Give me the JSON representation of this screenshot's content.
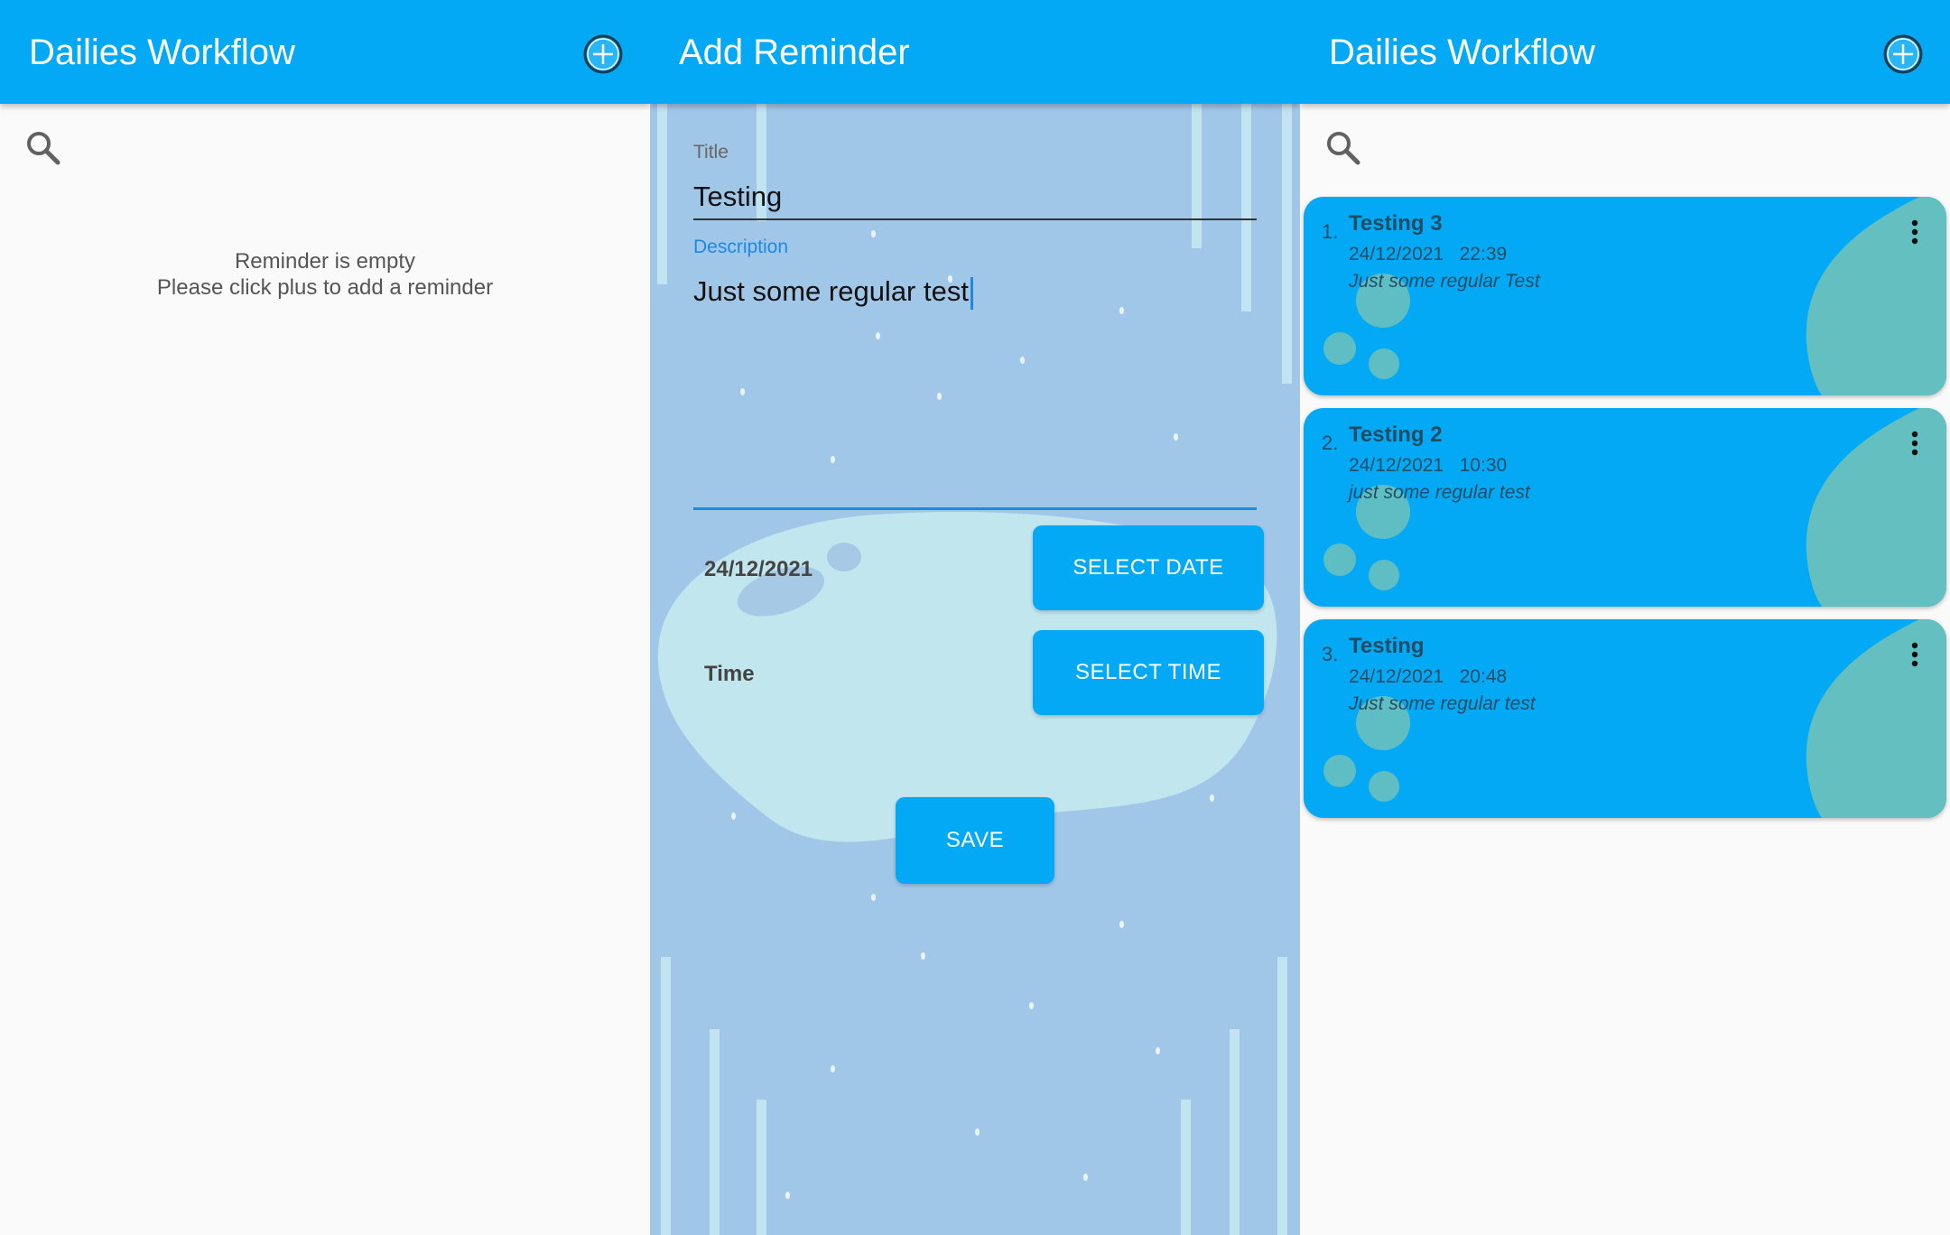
{
  "panels": {
    "list_empty": {
      "app_title": "Dailies Workflow",
      "empty_line1": "Reminder is empty",
      "empty_line2": "Please click plus to add a reminder"
    },
    "add_reminder": {
      "app_title": "Add Reminder",
      "title_label": "Title",
      "title_value": "Testing",
      "description_label": "Description",
      "description_value": "Just some regular test",
      "date_value": "24/12/2021",
      "select_date_label": "SELECT DATE",
      "time_label": "Time",
      "select_time_label": "SELECT TIME",
      "save_label": "SAVE"
    },
    "list": {
      "app_title": "Dailies Workflow",
      "reminders": [
        {
          "index": "1.",
          "title": "Testing 3",
          "date": "24/12/2021",
          "time": "22:39",
          "description": "Just some regular Test"
        },
        {
          "index": "2.",
          "title": "Testing 2",
          "date": "24/12/2021",
          "time": "10:30",
          "description": "just some regular test"
        },
        {
          "index": "3.",
          "title": "Testing",
          "date": "24/12/2021",
          "time": "20:48",
          "description": "Just some regular test"
        }
      ]
    }
  },
  "colors": {
    "primary": "#03a9f4",
    "accent_teal": "#64bfc0",
    "form_background": "#a1c7e8",
    "blob": "#c2e6ee"
  },
  "icons": {
    "add": "plus-circle-icon",
    "search": "search-icon",
    "menu": "more-vert-icon"
  }
}
